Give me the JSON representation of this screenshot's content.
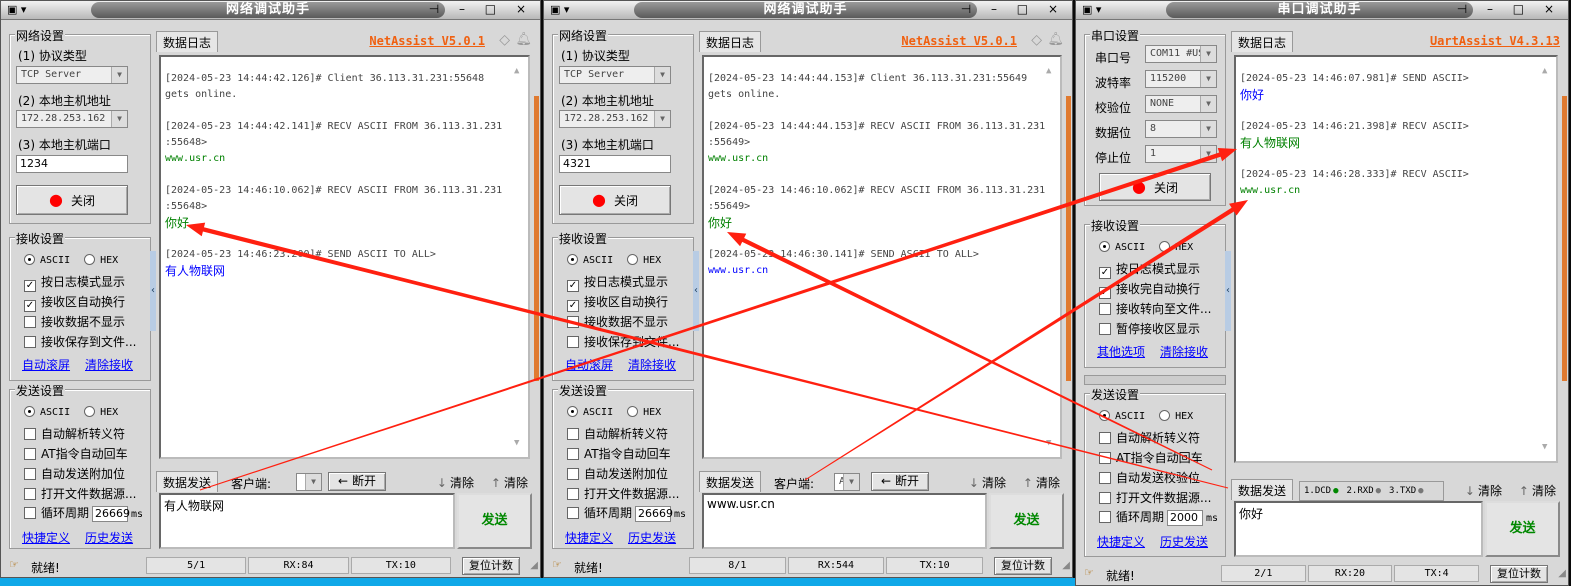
{
  "windows": [
    {
      "kind": "net",
      "title": "网络调试助手",
      "version": "NetAssist V5.0.1",
      "settings": {
        "group": "网络设置",
        "protocol_label": "(1) 协议类型",
        "protocol": "TCP Server",
        "host_label": "(2) 本地主机地址",
        "host": "172.28.253.162",
        "port_label": "(3) 本地主机端口",
        "port": "1234",
        "toggle": "关闭"
      },
      "recv": {
        "group": "接收设置",
        "ascii": "ASCII",
        "hex": "HEX",
        "checks": [
          {
            "label": "按日志模式显示",
            "checked": true
          },
          {
            "label": "接收区自动换行",
            "checked": true
          },
          {
            "label": "接收数据不显示",
            "checked": false
          },
          {
            "label": "接收保存到文件...",
            "checked": false
          }
        ],
        "link1": "自动滚屏",
        "link2": "清除接收"
      },
      "send": {
        "group": "发送设置",
        "ascii": "ASCII",
        "hex": "HEX",
        "checks": [
          "自动解析转义符",
          "AT指令自动回车",
          "自动发送附加位",
          "打开文件数据源..."
        ],
        "loop_label": "循环周期",
        "loop": "26669",
        "ms": "ms",
        "link1": "快捷定义",
        "link2": "历史发送"
      },
      "log_tab": "数据日志",
      "log": [
        {
          "lines": [
            "[2024-05-23 14:44:42.126]# Client 36.113.31.231:55648",
            "gets online."
          ]
        },
        {
          "lines": [
            "[2024-05-23 14:44:42.141]# RECV ASCII FROM 36.113.31.231",
            ":55648>"
          ],
          "body": "www.usr.cn",
          "color": "#008000"
        },
        {
          "lines": [
            "[2024-05-23 14:46:10.062]# RECV ASCII FROM 36.113.31.231",
            ":55648>"
          ],
          "body": "你好",
          "color": "#008000"
        },
        {
          "lines": [
            "[2024-05-23 14:46:23.200]# SEND ASCII TO ALL>"
          ],
          "body": "有人物联网",
          "color": "#0000ff"
        }
      ],
      "send_tab": "数据发送",
      "client_label": "客户端:",
      "client_value": "",
      "disconnect": "断开",
      "clear1": "清除",
      "clear2": "清除",
      "send_text": "有人物联网",
      "send_button": "发送",
      "status": {
        "ready": "就绪!",
        "count": "5/1",
        "rx": "RX:84",
        "tx": "TX:10",
        "reset": "复位计数"
      }
    },
    {
      "kind": "net",
      "title": "网络调试助手",
      "version": "NetAssist V5.0.1",
      "settings": {
        "group": "网络设置",
        "protocol_label": "(1) 协议类型",
        "protocol": "TCP Server",
        "host_label": "(2) 本地主机地址",
        "host": "172.28.253.162",
        "port_label": "(3) 本地主机端口",
        "port": "4321",
        "toggle": "关闭"
      },
      "recv": {
        "group": "接收设置",
        "ascii": "ASCII",
        "hex": "HEX",
        "checks": [
          {
            "label": "按日志模式显示",
            "checked": true
          },
          {
            "label": "接收区自动换行",
            "checked": true
          },
          {
            "label": "接收数据不显示",
            "checked": false
          },
          {
            "label": "接收保存到文件...",
            "checked": false
          }
        ],
        "link1": "自动滚屏",
        "link2": "清除接收"
      },
      "send": {
        "group": "发送设置",
        "ascii": "ASCII",
        "hex": "HEX",
        "checks": [
          "自动解析转义符",
          "AT指令自动回车",
          "自动发送附加位",
          "打开文件数据源..."
        ],
        "loop_label": "循环周期",
        "loop": "26669",
        "ms": "ms",
        "link1": "快捷定义",
        "link2": "历史发送"
      },
      "log_tab": "数据日志",
      "log": [
        {
          "lines": [
            "[2024-05-23 14:44:44.153]# Client 36.113.31.231:55649",
            "gets online."
          ]
        },
        {
          "lines": [
            "[2024-05-23 14:44:44.153]# RECV ASCII FROM 36.113.31.231",
            ":55649>"
          ],
          "body": "www.usr.cn",
          "color": "#008000"
        },
        {
          "lines": [
            "[2024-05-23 14:46:10.062]# RECV ASCII FROM 36.113.31.231",
            ":55649>"
          ],
          "body": "你好",
          "color": "#008000"
        },
        {
          "lines": [
            "[2024-05-23 14:46:30.141]# SEND ASCII TO ALL>"
          ],
          "body": "www.usr.cn",
          "color": "#0000ff"
        }
      ],
      "send_tab": "数据发送",
      "client_label": "客户端:",
      "client_value": "A",
      "disconnect": "断开",
      "clear1": "清除",
      "clear2": "清除",
      "send_text": "www.usr.cn",
      "send_button": "发送",
      "status": {
        "ready": "就绪!",
        "count": "8/1",
        "rx": "RX:544",
        "tx": "TX:10",
        "reset": "复位计数"
      }
    },
    {
      "kind": "uart",
      "title": "串口调试助手",
      "version": "UartAssist V4.3.13",
      "settings": {
        "group": "串口设置",
        "rows": [
          {
            "label": "串口号",
            "value": "COM11 #US"
          },
          {
            "label": "波特率",
            "value": "115200"
          },
          {
            "label": "校验位",
            "value": "NONE"
          },
          {
            "label": "数据位",
            "value": "8"
          },
          {
            "label": "停止位",
            "value": "1"
          }
        ],
        "toggle": "关闭"
      },
      "recv": {
        "group": "接收设置",
        "ascii": "ASCII",
        "hex": "HEX",
        "checks": [
          {
            "label": "按日志模式显示",
            "checked": true
          },
          {
            "label": "接收完自动换行",
            "checked": true
          },
          {
            "label": "接收转向至文件...",
            "checked": false
          },
          {
            "label": "暂停接收区显示",
            "checked": false
          }
        ],
        "link1": "其他选项",
        "link2": "清除接收"
      },
      "send": {
        "group": "发送设置",
        "ascii": "ASCII",
        "hex": "HEX",
        "checks": [
          "自动解析转义符",
          "AT指令自动回车",
          "自动发送校验位",
          "打开文件数据源..."
        ],
        "loop_label": "循环周期",
        "loop": "2000",
        "ms": "ms",
        "link1": "快捷定义",
        "link2": "历史发送"
      },
      "log_tab": "数据日志",
      "log": [
        {
          "lines": [
            "[2024-05-23 14:46:07.981]# SEND ASCII>"
          ],
          "body": "你好",
          "color": "#0000ff"
        },
        {
          "lines": [
            "[2024-05-23 14:46:21.398]# RECV ASCII>"
          ],
          "body": "有人物联网",
          "color": "#008000"
        },
        {
          "lines": [
            "[2024-05-23 14:46:28.333]# RECV ASCII>"
          ],
          "body": "www.usr.cn",
          "color": "#008000"
        }
      ],
      "send_tab": "数据发送",
      "pins": [
        "1.DCD",
        "2.RXD",
        "3.TXD"
      ],
      "clear1": "清除",
      "clear2": "清除",
      "send_text": "你好",
      "send_button": "发送",
      "status": {
        "ready": "就绪!",
        "count": "2/1",
        "rx": "RX:20",
        "tx": "TX:4",
        "reset": "复位计数"
      }
    }
  ],
  "colors": {
    "annotation": "#ff2010",
    "accent": "#f06010"
  }
}
